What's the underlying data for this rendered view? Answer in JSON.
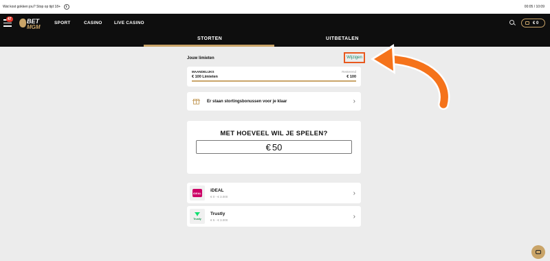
{
  "topbar": {
    "warning": "Wat kost gokken jou? Stop op tijd 18+",
    "time": "00:05 / 10:09"
  },
  "header": {
    "badge_count": "47",
    "logo_top": "BET",
    "logo_bottom": "MGM",
    "nav": [
      "SPORT",
      "CASINO",
      "LIVE CASINO"
    ],
    "wallet_label": "€ 0"
  },
  "tabs": {
    "deposit": "STORTEN",
    "withdraw": "UITBETALEN",
    "active": "STORTEN"
  },
  "limits": {
    "section_label": "Jouw limieten",
    "edit_label": "Wijzigen",
    "period": "MAANDELIJKS",
    "remaining_label": "Resterend",
    "limit_value": "€ 100 Limieten",
    "remaining_value": "€ 100"
  },
  "bonus": {
    "text": "Er staan stortingsbonussen voor je klaar"
  },
  "amount": {
    "title": "MET HOEVEEL WIL JE SPELEN?",
    "currency": "€",
    "value": "50"
  },
  "payments": [
    {
      "name": "iDEAL",
      "range": "€ 0 - € 3.000",
      "logo_text": "iDEAL"
    },
    {
      "name": "Trustly",
      "range": "€ 5 - € 3.000",
      "logo_text": "Trustly"
    }
  ],
  "colors": {
    "accent_gold": "#c9a468",
    "highlight_orange": "#e8581d",
    "link_green": "#1a8a6a",
    "header_bg": "#0e0e0e"
  }
}
